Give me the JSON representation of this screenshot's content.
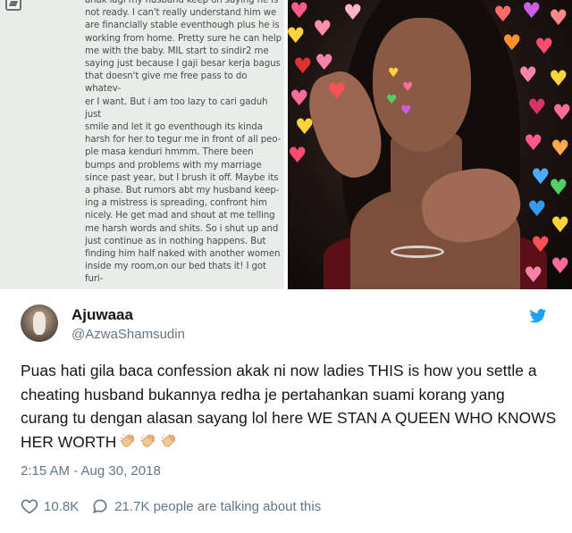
{
  "confession": {
    "text": "anak lagi my husband keep on saying he is\nnot ready. I can't really understand him we\nare financially stable eventhough plus he is\nworking from home. Pretty sure he can help\nme with the baby. MIL start to sindir2 me\nsaying just because I gaji besar kerja bagus\nthat doesn't give me free pass to do whatev-\ner I want. But i am too lazy to cari gaduh just\nsmile and let it go eventhough its kinda\nharsh for her to tegur me in front of all peo-\nple masa kenduri hmmm. There been\nbumps and problems with my marriage\nsince past year, but I brush it off. Maybe its\na phase. But rumors abt my husband keep-\ning a mistress is spreading, confront him\nnicely. He get mad and shout at me telling\nme harsh words and shits. So i shut up and\njust continue as in nothing happens. But\nfinding him half naked with another women\ninside my room,on our bed thats it! I got furi-"
  },
  "tweet": {
    "display_name": "Ajuwaaa",
    "handle": "@AzwaShamsudin",
    "body": "Puas hati gila baca confession akak ni now ladies THIS is how you settle a cheating husband bukannya redha je pertahankan suami korang yang curang tu dengan alasan sayang lol here WE STAN A QUEEN WHO KNOWS HER WORTH",
    "emoji": [
      "clapping-hands",
      "clapping-hands",
      "clapping-hands"
    ],
    "timestamp": "2:15 AM - Aug 30, 2018",
    "likes": "10.8K",
    "talking": "21.7K people are talking about this"
  },
  "icons": {
    "brand": "twitter-bird-icon",
    "like": "heart-outline-icon",
    "reply": "speech-bubble-icon"
  },
  "colors": {
    "twitter_blue": "#1da1f2",
    "text_primary": "#14171a",
    "text_secondary": "#657786"
  }
}
